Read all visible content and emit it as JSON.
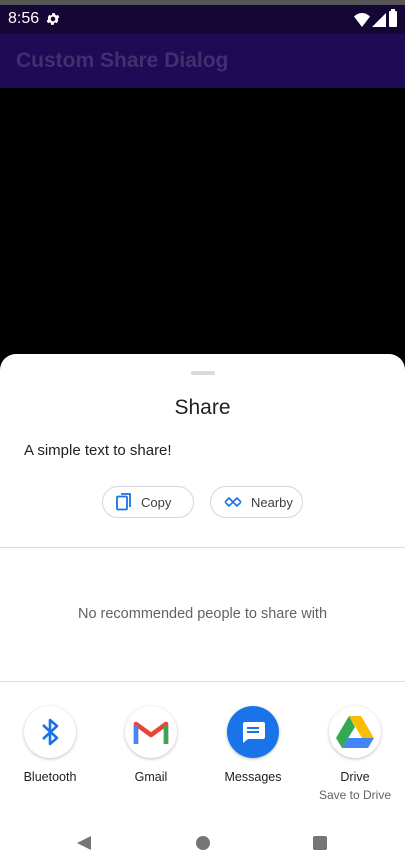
{
  "status_bar": {
    "time": "8:56"
  },
  "app_bar": {
    "title": "Custom Share Dialog"
  },
  "share_sheet": {
    "title": "Share",
    "shared_text": "A simple text to share!",
    "chips": [
      {
        "label": "Copy",
        "icon": "copy-icon"
      },
      {
        "label": "Nearby",
        "icon": "nearby-icon"
      }
    ],
    "no_recommendations": "No recommended people to share with",
    "apps": [
      {
        "label": "Bluetooth",
        "icon": "bluetooth-icon"
      },
      {
        "label": "Gmail",
        "icon": "gmail-icon"
      },
      {
        "label": "Messages",
        "icon": "messages-icon"
      },
      {
        "label": "Drive",
        "sublabel": "Save to Drive",
        "icon": "drive-icon"
      }
    ]
  },
  "colors": {
    "status_bar": "#150636",
    "app_bar": "#1f0a55",
    "accent_blue": "#1a73e8"
  }
}
